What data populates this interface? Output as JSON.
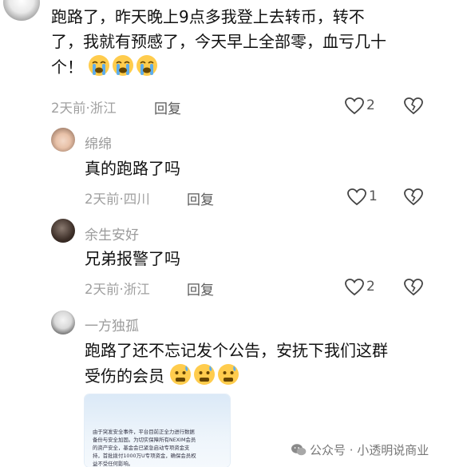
{
  "comments": [
    {
      "text_lines": [
        "跑路了，昨天晚上9点多我登上去转币，转不",
        "了，我就有预感了，今天早上全部零，血亏几十",
        "个！"
      ],
      "emoji": "loudly-crying-face",
      "emoji_count": 3,
      "meta": "2天前·浙江",
      "reply_label": "回复",
      "likes": "2"
    },
    {
      "name": "绵绵",
      "text": "真的跑路了吗",
      "meta": "2天前·四川",
      "reply_label": "回复",
      "likes": "1"
    },
    {
      "name": "余生安好",
      "text": "兄弟报警了吗",
      "meta": "2天前·浙江",
      "reply_label": "回复",
      "likes": "2"
    },
    {
      "name": "一方独孤",
      "text_lines": [
        "跑路了还不忘记发个公告，安抚下我们这群",
        "受伤的会员"
      ],
      "emoji": "anxious-face-with-sweat",
      "emoji_count": 3,
      "notice_lines": [
        "由于突发安全事件，平台目前正全力进行数据",
        "备份与安全加固。为切实保障所有NEXIM会员",
        "的资产安全，基金会已紧急启动专项资金支",
        "持，首批拨付1000万U专项资金，确保会员权",
        "益不受任何影响。"
      ]
    }
  ],
  "watermark": {
    "label": "公众号 · 小透明说商业"
  },
  "colors": {
    "text": "#111111",
    "meta": "#a0a0a0",
    "name": "#9b9b9b"
  }
}
